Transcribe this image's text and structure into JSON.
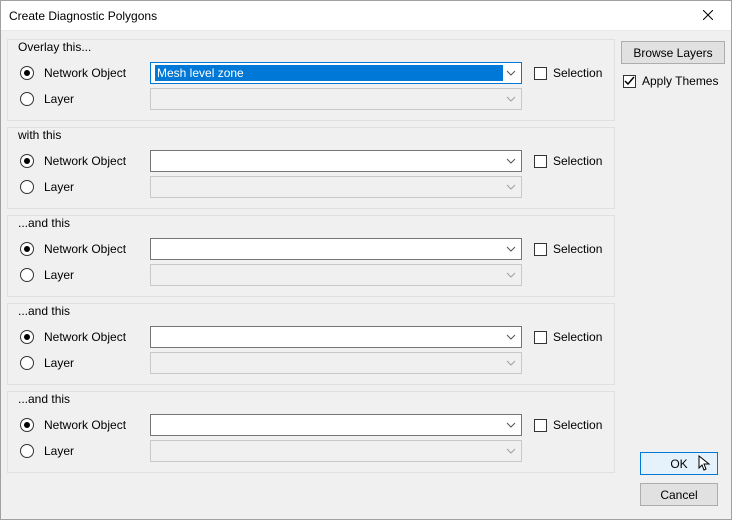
{
  "window": {
    "title": "Create Diagnostic Polygons"
  },
  "groups": [
    {
      "legend": "Overlay this...",
      "netobj_value": "Mesh level zone",
      "highlighted": true,
      "layer_value": "",
      "selection_label": "Selection",
      "netobj_label": "Network Object",
      "layer_label": "Layer",
      "show_selection": true
    },
    {
      "legend": "with this",
      "netobj_value": "",
      "highlighted": false,
      "layer_value": "",
      "selection_label": "Selection",
      "netobj_label": "Network Object",
      "layer_label": "Layer",
      "show_selection": true
    },
    {
      "legend": "...and this",
      "netobj_value": "",
      "highlighted": false,
      "layer_value": "",
      "selection_label": "Selection",
      "netobj_label": "Network Object",
      "layer_label": "Layer",
      "show_selection": true
    },
    {
      "legend": "...and this",
      "netobj_value": "",
      "highlighted": false,
      "layer_value": "",
      "selection_label": "Selection",
      "netobj_label": "Network Object",
      "layer_label": "Layer",
      "show_selection": true
    },
    {
      "legend": "...and this",
      "netobj_value": "",
      "highlighted": false,
      "layer_value": "",
      "selection_label": "Selection",
      "netobj_label": "Network Object",
      "layer_label": "Layer",
      "show_selection": true
    }
  ],
  "side": {
    "browse_layers": "Browse Layers",
    "apply_themes": "Apply Themes",
    "apply_themes_checked": true
  },
  "actions": {
    "ok": "OK",
    "cancel": "Cancel"
  }
}
